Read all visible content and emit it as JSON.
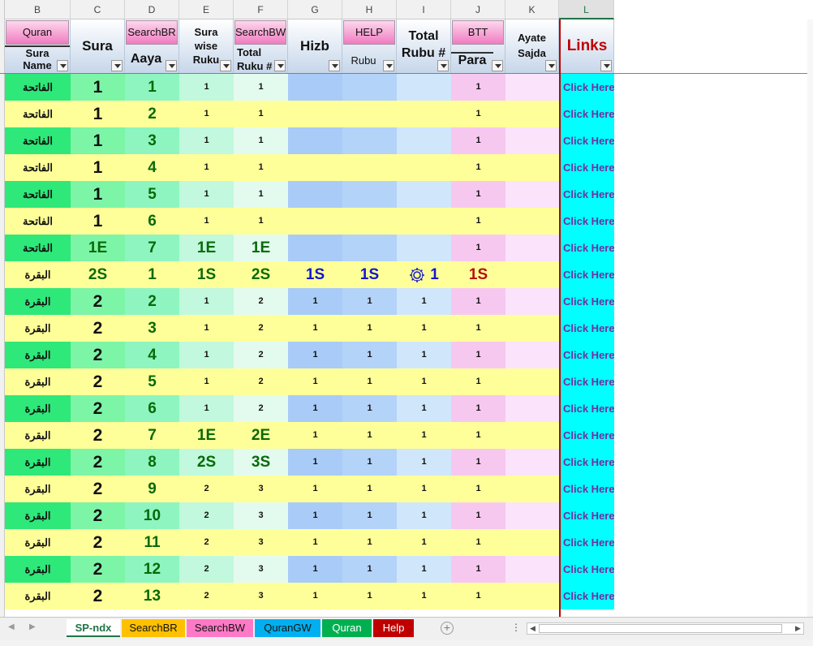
{
  "columns": [
    {
      "letter": "B",
      "selected": false
    },
    {
      "letter": "C",
      "selected": false
    },
    {
      "letter": "D",
      "selected": false
    },
    {
      "letter": "E",
      "selected": false
    },
    {
      "letter": "F",
      "selected": false
    },
    {
      "letter": "G",
      "selected": false
    },
    {
      "letter": "H",
      "selected": false
    },
    {
      "letter": "I",
      "selected": false
    },
    {
      "letter": "J",
      "selected": false
    },
    {
      "letter": "K",
      "selected": false
    },
    {
      "letter": "L",
      "selected": true
    }
  ],
  "header": {
    "b": {
      "button": "Quran",
      "label1": "Sura",
      "label2": "Name"
    },
    "c": {
      "label": "Sura"
    },
    "d": {
      "button": "SearchBR",
      "label": "Aaya"
    },
    "e": {
      "label1": "Sura",
      "label2": "wise",
      "label3": "Ruku"
    },
    "f": {
      "button": "SearchBW",
      "label1": "Total",
      "label2": "Ruku #"
    },
    "g": {
      "label": "Hizb"
    },
    "h": {
      "button": "HELP",
      "label": "Rubu"
    },
    "i": {
      "label1": "Total",
      "label2": "Rubu #"
    },
    "j": {
      "button": "BTT",
      "label": "Para"
    },
    "k": {
      "label1": "Ayate",
      "label2": "Sajda"
    },
    "l": {
      "label": "Links"
    }
  },
  "colors": {
    "sura_green": "#2ee87a",
    "sura_yellow": "#ffff99",
    "c_green": "#7cf5a7",
    "d_green": "#8ef5c0",
    "e_green": "#c2f8dd",
    "f_green": "#e3fbef",
    "g_blue": "#a9cbf7",
    "h_blue": "#b4d3f9",
    "i_blue": "#d0e6fb",
    "j_pink": "#f6c8f0",
    "k_pink": "#fae3fb",
    "links_cyan": "#00ffff",
    "yellow": "#ffff99"
  },
  "rows": [
    {
      "stripe": "green",
      "sura": "الفاتحة",
      "c": "1",
      "c_style": "big",
      "d": "1",
      "d_style": "med",
      "e": "1",
      "e_style": "sm",
      "f": "1",
      "f_style": "sm",
      "g": "",
      "g_style": "sm",
      "h": "",
      "h_style": "sm",
      "i": "",
      "i_style": "sm",
      "i_icon": false,
      "j": "1",
      "j_style": "sm",
      "link": "Click Here"
    },
    {
      "stripe": "yellow",
      "sura": "الفاتحة",
      "c": "1",
      "c_style": "big",
      "d": "2",
      "d_style": "med",
      "e": "1",
      "e_style": "sm",
      "f": "1",
      "f_style": "sm",
      "g": "",
      "g_style": "sm",
      "h": "",
      "h_style": "sm",
      "i": "",
      "i_style": "sm",
      "i_icon": false,
      "j": "1",
      "j_style": "sm",
      "link": "Click Here"
    },
    {
      "stripe": "green",
      "sura": "الفاتحة",
      "c": "1",
      "c_style": "big",
      "d": "3",
      "d_style": "med",
      "e": "1",
      "e_style": "sm",
      "f": "1",
      "f_style": "sm",
      "g": "",
      "g_style": "sm",
      "h": "",
      "h_style": "sm",
      "i": "",
      "i_style": "sm",
      "i_icon": false,
      "j": "1",
      "j_style": "sm",
      "link": "Click Here"
    },
    {
      "stripe": "yellow",
      "sura": "الفاتحة",
      "c": "1",
      "c_style": "big",
      "d": "4",
      "d_style": "med",
      "e": "1",
      "e_style": "sm",
      "f": "1",
      "f_style": "sm",
      "g": "",
      "g_style": "sm",
      "h": "",
      "h_style": "sm",
      "i": "",
      "i_style": "sm",
      "i_icon": false,
      "j": "1",
      "j_style": "sm",
      "link": "Click Here"
    },
    {
      "stripe": "green",
      "sura": "الفاتحة",
      "c": "1",
      "c_style": "big",
      "d": "5",
      "d_style": "med",
      "e": "1",
      "e_style": "sm",
      "f": "1",
      "f_style": "sm",
      "g": "",
      "g_style": "sm",
      "h": "",
      "h_style": "sm",
      "i": "",
      "i_style": "sm",
      "i_icon": false,
      "j": "1",
      "j_style": "sm",
      "link": "Click Here"
    },
    {
      "stripe": "yellow",
      "sura": "الفاتحة",
      "c": "1",
      "c_style": "big",
      "d": "6",
      "d_style": "med",
      "e": "1",
      "e_style": "sm",
      "f": "1",
      "f_style": "sm",
      "g": "",
      "g_style": "sm",
      "h": "",
      "h_style": "sm",
      "i": "",
      "i_style": "sm",
      "i_icon": false,
      "j": "1",
      "j_style": "sm",
      "link": "Click Here"
    },
    {
      "stripe": "green",
      "sura": "الفاتحة",
      "c": "1E",
      "c_style": "med",
      "d": "7",
      "d_style": "med",
      "e": "1E",
      "e_style": "med",
      "f": "1E",
      "f_style": "med",
      "g": "",
      "g_style": "sm",
      "h": "",
      "h_style": "sm",
      "i": "",
      "i_style": "sm",
      "i_icon": false,
      "j": "1",
      "j_style": "sm",
      "link": "Click Here"
    },
    {
      "stripe": "yellow",
      "sura": "البقرة",
      "c": "2S",
      "c_style": "med",
      "d": "1",
      "d_style": "med",
      "e": "1S",
      "e_style": "med",
      "f": "2S",
      "f_style": "med",
      "g": "1S",
      "g_style": "blue",
      "h": "1S",
      "h_style": "blue",
      "i": "1",
      "i_style": "blue",
      "i_icon": true,
      "j": "1S",
      "j_style": "red",
      "link": "Click Here"
    },
    {
      "stripe": "green",
      "sura": "البقرة",
      "c": "2",
      "c_style": "big",
      "d": "2",
      "d_style": "med",
      "e": "1",
      "e_style": "sm",
      "f": "2",
      "f_style": "sm",
      "g": "1",
      "g_style": "sm",
      "h": "1",
      "h_style": "sm",
      "i": "1",
      "i_style": "sm",
      "i_icon": false,
      "j": "1",
      "j_style": "sm",
      "link": "Click Here"
    },
    {
      "stripe": "yellow",
      "sura": "البقرة",
      "c": "2",
      "c_style": "big",
      "d": "3",
      "d_style": "med",
      "e": "1",
      "e_style": "sm",
      "f": "2",
      "f_style": "sm",
      "g": "1",
      "g_style": "sm",
      "h": "1",
      "h_style": "sm",
      "i": "1",
      "i_style": "sm",
      "i_icon": false,
      "j": "1",
      "j_style": "sm",
      "link": "Click Here"
    },
    {
      "stripe": "green",
      "sura": "البقرة",
      "c": "2",
      "c_style": "big",
      "d": "4",
      "d_style": "med",
      "e": "1",
      "e_style": "sm",
      "f": "2",
      "f_style": "sm",
      "g": "1",
      "g_style": "sm",
      "h": "1",
      "h_style": "sm",
      "i": "1",
      "i_style": "sm",
      "i_icon": false,
      "j": "1",
      "j_style": "sm",
      "link": "Click Here"
    },
    {
      "stripe": "yellow",
      "sura": "البقرة",
      "c": "2",
      "c_style": "big",
      "d": "5",
      "d_style": "med",
      "e": "1",
      "e_style": "sm",
      "f": "2",
      "f_style": "sm",
      "g": "1",
      "g_style": "sm",
      "h": "1",
      "h_style": "sm",
      "i": "1",
      "i_style": "sm",
      "i_icon": false,
      "j": "1",
      "j_style": "sm",
      "link": "Click Here"
    },
    {
      "stripe": "green",
      "sura": "البقرة",
      "c": "2",
      "c_style": "big",
      "d": "6",
      "d_style": "med",
      "e": "1",
      "e_style": "sm",
      "f": "2",
      "f_style": "sm",
      "g": "1",
      "g_style": "sm",
      "h": "1",
      "h_style": "sm",
      "i": "1",
      "i_style": "sm",
      "i_icon": false,
      "j": "1",
      "j_style": "sm",
      "link": "Click Here"
    },
    {
      "stripe": "yellow",
      "sura": "البقرة",
      "c": "2",
      "c_style": "big",
      "d": "7",
      "d_style": "med",
      "e": "1E",
      "e_style": "med",
      "f": "2E",
      "f_style": "med",
      "g": "1",
      "g_style": "sm",
      "h": "1",
      "h_style": "sm",
      "i": "1",
      "i_style": "sm",
      "i_icon": false,
      "j": "1",
      "j_style": "sm",
      "link": "Click Here"
    },
    {
      "stripe": "green",
      "sura": "البقرة",
      "c": "2",
      "c_style": "big",
      "d": "8",
      "d_style": "med",
      "e": "2S",
      "e_style": "med",
      "f": "3S",
      "f_style": "med",
      "g": "1",
      "g_style": "sm",
      "h": "1",
      "h_style": "sm",
      "i": "1",
      "i_style": "sm",
      "i_icon": false,
      "j": "1",
      "j_style": "sm",
      "link": "Click Here"
    },
    {
      "stripe": "yellow",
      "sura": "البقرة",
      "c": "2",
      "c_style": "big",
      "d": "9",
      "d_style": "med",
      "e": "2",
      "e_style": "sm",
      "f": "3",
      "f_style": "sm",
      "g": "1",
      "g_style": "sm",
      "h": "1",
      "h_style": "sm",
      "i": "1",
      "i_style": "sm",
      "i_icon": false,
      "j": "1",
      "j_style": "sm",
      "link": "Click Here"
    },
    {
      "stripe": "green",
      "sura": "البقرة",
      "c": "2",
      "c_style": "big",
      "d": "10",
      "d_style": "med",
      "e": "2",
      "e_style": "sm",
      "f": "3",
      "f_style": "sm",
      "g": "1",
      "g_style": "sm",
      "h": "1",
      "h_style": "sm",
      "i": "1",
      "i_style": "sm",
      "i_icon": false,
      "j": "1",
      "j_style": "sm",
      "link": "Click Here"
    },
    {
      "stripe": "yellow",
      "sura": "البقرة",
      "c": "2",
      "c_style": "big",
      "d": "11",
      "d_style": "med",
      "e": "2",
      "e_style": "sm",
      "f": "3",
      "f_style": "sm",
      "g": "1",
      "g_style": "sm",
      "h": "1",
      "h_style": "sm",
      "i": "1",
      "i_style": "sm",
      "i_icon": false,
      "j": "1",
      "j_style": "sm",
      "link": "Click Here"
    },
    {
      "stripe": "green",
      "sura": "البقرة",
      "c": "2",
      "c_style": "big",
      "d": "12",
      "d_style": "med",
      "e": "2",
      "e_style": "sm",
      "f": "3",
      "f_style": "sm",
      "g": "1",
      "g_style": "sm",
      "h": "1",
      "h_style": "sm",
      "i": "1",
      "i_style": "sm",
      "i_icon": false,
      "j": "1",
      "j_style": "sm",
      "link": "Click Here"
    },
    {
      "stripe": "yellow",
      "sura": "البقرة",
      "c": "2",
      "c_style": "big",
      "d": "13",
      "d_style": "med",
      "e": "2",
      "e_style": "sm",
      "f": "3",
      "f_style": "sm",
      "g": "1",
      "g_style": "sm",
      "h": "1",
      "h_style": "sm",
      "i": "1",
      "i_style": "sm",
      "i_icon": false,
      "j": "1",
      "j_style": "sm",
      "link": "Click Here"
    }
  ],
  "tabs": [
    {
      "label": "SP-ndx",
      "color": "#ffffff",
      "active": true
    },
    {
      "label": "SearchBR",
      "color": "#ffc000",
      "active": false
    },
    {
      "label": "SearchBW",
      "color": "#ff79c6",
      "active": false
    },
    {
      "label": "QuranGW",
      "color": "#00b0f0",
      "active": false
    },
    {
      "label": "Quran",
      "color": "#00b050",
      "active": false
    },
    {
      "label": "Help",
      "color": "#c00000",
      "active": false
    }
  ]
}
